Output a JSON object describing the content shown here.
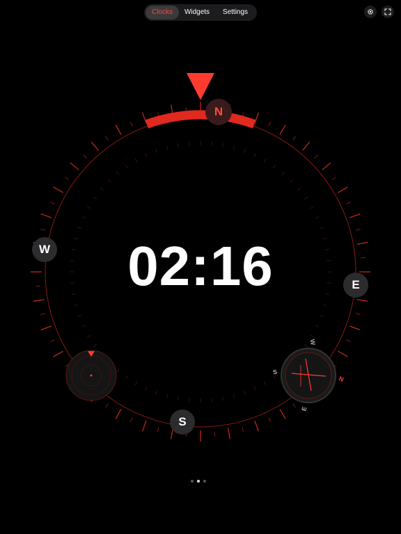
{
  "tabs": [
    {
      "label": "Clocks",
      "active": true
    },
    {
      "label": "Widgets",
      "active": false
    },
    {
      "label": "Settings",
      "active": false
    }
  ],
  "toolbar": {
    "settings_icon": "gear-icon",
    "fullscreen_icon": "expand-icon"
  },
  "compass": {
    "north_label": "N",
    "east_label": "E",
    "south_label": "S",
    "west_label": "W",
    "accent_color": "#ff3b30"
  },
  "clock": {
    "time": "02:16"
  },
  "mini_compass": {
    "w": "W",
    "s": "S",
    "n": "N",
    "e": "E"
  },
  "pager": {
    "page_count": 3,
    "current_page": 2
  }
}
